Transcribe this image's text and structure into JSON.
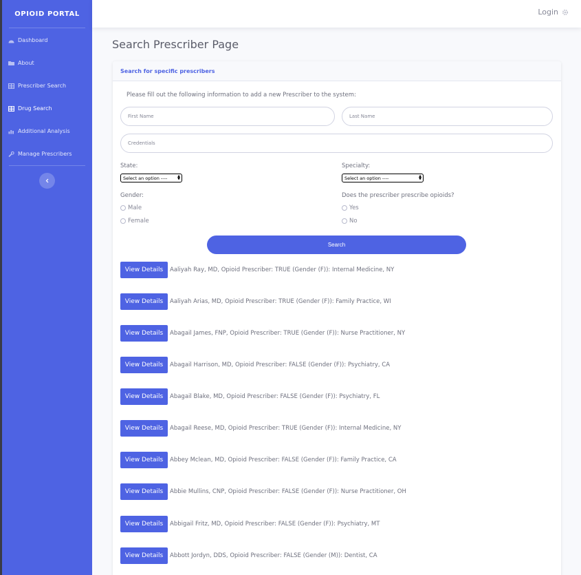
{
  "sidebar": {
    "brand": "OPIOID PORTAL",
    "items": [
      {
        "label": "Dashboard",
        "icon": "dashboard-icon"
      },
      {
        "label": "About",
        "icon": "folder-icon"
      },
      {
        "label": "Prescriber Search",
        "icon": "table-icon"
      },
      {
        "label": "Drug Search",
        "icon": "table-icon",
        "active": true
      },
      {
        "label": "Additional Analysis",
        "icon": "chart-icon"
      },
      {
        "label": "Manage Prescribers",
        "icon": "wrench-icon"
      }
    ],
    "toggle_icon": "chevron-left-icon"
  },
  "topbar": {
    "login_label": "Login",
    "login_icon": "gear-icon"
  },
  "page": {
    "title": "Search Prescriber Page"
  },
  "card": {
    "header": "Search for specific prescribers",
    "intro": "Please fill out the following information to add a new Prescriber to the system:",
    "first_name_placeholder": "First Name",
    "last_name_placeholder": "Last Name",
    "credentials_placeholder": "Credentials",
    "state_label": "State:",
    "state_selected": "Select an option ----",
    "specialty_label": "Specialty:",
    "specialty_selected": "Select an option ----",
    "gender_label": "Gender:",
    "gender_options": [
      "Male",
      "Female"
    ],
    "opioid_label": "Does the prescriber prescribe opioids?",
    "opioid_options": [
      "Yes",
      "No"
    ],
    "search_label": "Search"
  },
  "results": {
    "button_label": "View Details",
    "items": [
      "Aaliyah Ray, MD, Opioid Prescriber: TRUE (Gender (F)): Internal Medicine, NY",
      "Aaliyah Arias, MD, Opioid Prescriber: TRUE (Gender (F)): Family Practice, WI",
      "Abagail James, FNP, Opioid Prescriber: TRUE (Gender (F)): Nurse Practitioner, NY",
      "Abagail Harrison, MD, Opioid Prescriber: FALSE (Gender (F)): Psychiatry, CA",
      "Abagail Blake, MD, Opioid Prescriber: FALSE (Gender (F)): Psychiatry, FL",
      "Abagail Reese, MD, Opioid Prescriber: TRUE (Gender (F)): Internal Medicine, NY",
      "Abbey Mclean, MD, Opioid Prescriber: FALSE (Gender (F)): Family Practice, CA",
      "Abbie Mullins, CNP, Opioid Prescriber: FALSE (Gender (F)): Nurse Practitioner, OH",
      "Abbigail Fritz, MD, Opioid Prescriber: FALSE (Gender (F)): Psychiatry, MT",
      "Abbott Jordyn, DDS, Opioid Prescriber: FALSE (Gender (M)): Dentist, CA"
    ]
  },
  "colors": {
    "primary": "#4e63e3",
    "sidebar": "#4e63e3",
    "text_muted": "#858796",
    "background": "#f8f9fc"
  }
}
